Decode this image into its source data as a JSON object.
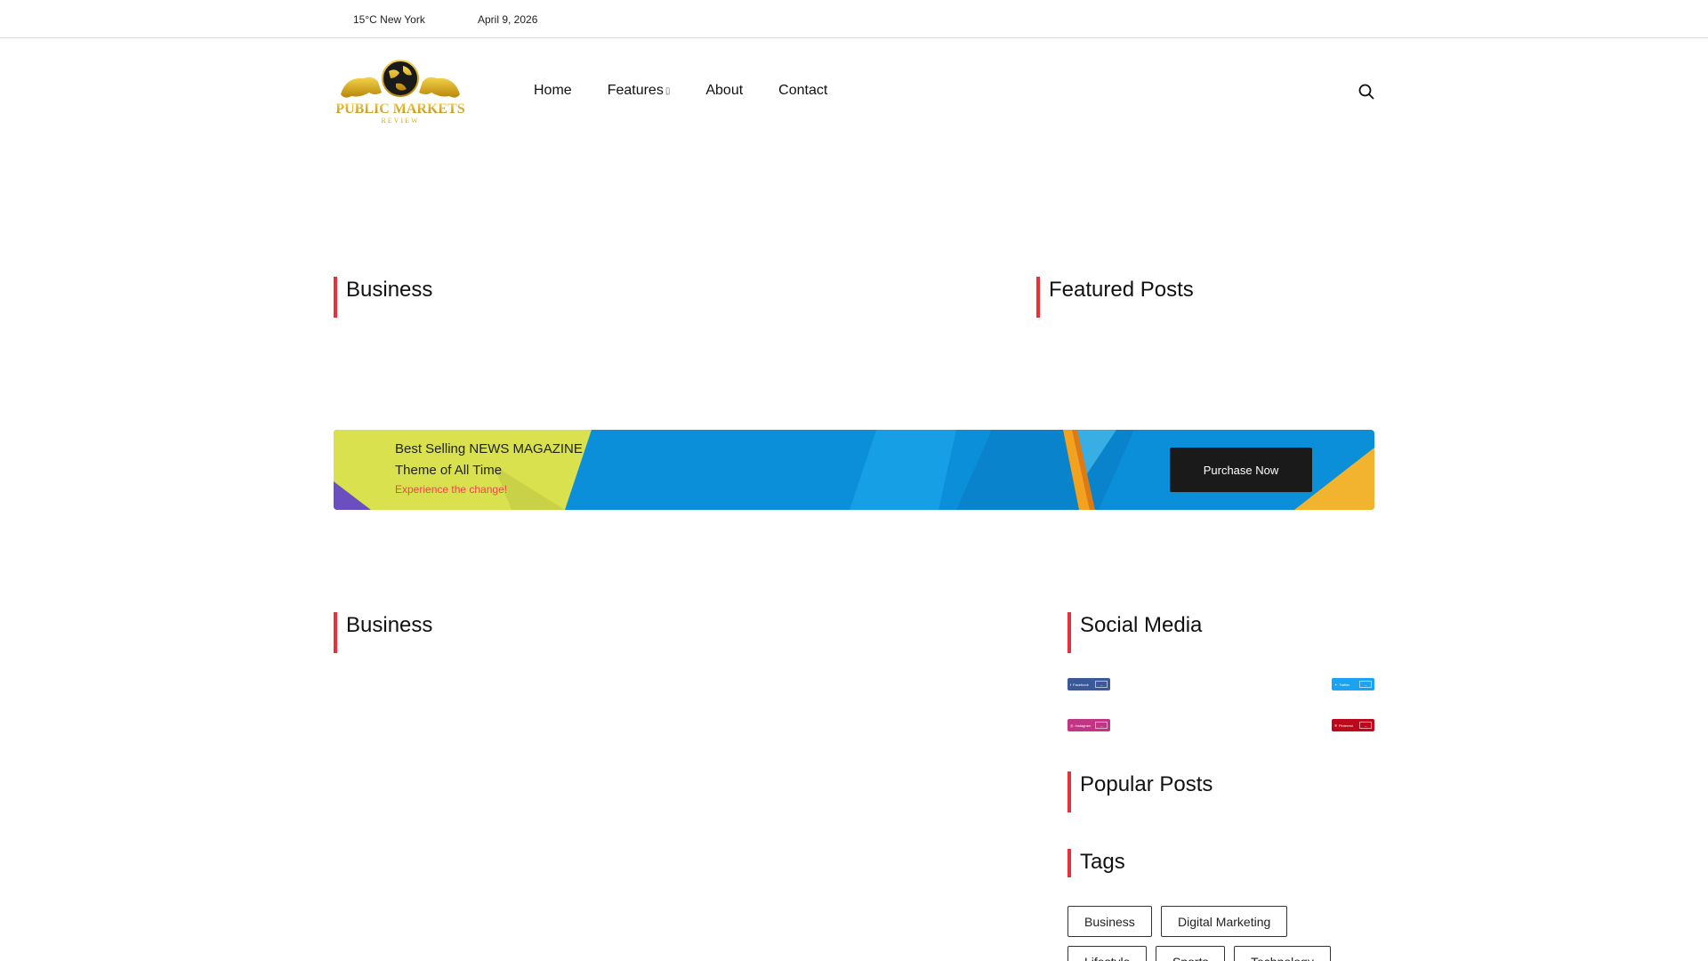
{
  "topbar": {
    "weather": "15°C New York",
    "date": "April 9, 2026"
  },
  "logo": {
    "line1": "PUBLIC MARKETS",
    "line2": "REVIEW",
    "gold": "#d9a21b"
  },
  "nav": {
    "items": [
      {
        "label": "Home"
      },
      {
        "label": "Features"
      },
      {
        "label": "About"
      },
      {
        "label": "Contact"
      }
    ],
    "features_caret": "▯"
  },
  "sections": {
    "business_top": "Business",
    "featured_posts": "Featured Posts",
    "business_bottom": "Business",
    "social_media": "Social Media",
    "popular_posts": "Popular Posts",
    "tags": "Tags"
  },
  "banner": {
    "line1": "Best Selling NEWS MAGAZINE",
    "line2": "Theme of All Time",
    "line3": "Experience the change!",
    "button": "Purchase Now",
    "colors": {
      "blue": "#0b8fd8",
      "yellow": "#d9e14f",
      "purple": "#6b4fc0",
      "orange": "#f2a21e"
    }
  },
  "social": [
    {
      "name": "Facebook",
      "color": "#3b5998"
    },
    {
      "name": "Twitter",
      "color": "#1da1f2"
    },
    {
      "name": "Instagram",
      "color": "#c13584"
    },
    {
      "name": "Pinterest",
      "color": "#bd081c"
    }
  ],
  "tags": [
    "Business",
    "Digital Marketing",
    "Lifestyle",
    "Sports",
    "Technology"
  ],
  "accent": "#e8303b"
}
